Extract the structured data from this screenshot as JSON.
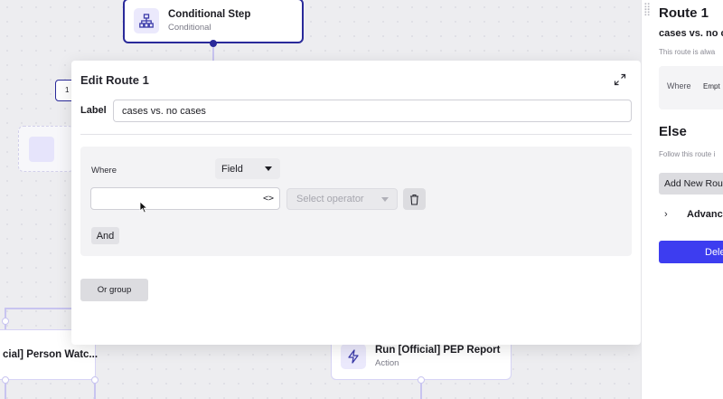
{
  "canvas": {
    "conditional_node": {
      "title": "Conditional Step",
      "subtitle": "Conditional"
    },
    "route_badge": "1",
    "person_node": {
      "title": "cial] Person Watc..."
    },
    "pep_node": {
      "title": "Run [Official] PEP Report",
      "subtitle": "Action"
    }
  },
  "modal": {
    "title": "Edit Route 1",
    "label_label": "Label",
    "label_value": "cases vs. no cases",
    "where_label": "Where",
    "field_select": "Field",
    "condition_value": "",
    "operator_placeholder": "Select operator",
    "and_button": "And",
    "or_group_button": "Or group"
  },
  "panel": {
    "title": "Route 1",
    "route_label": "cases vs. no c",
    "always_text": "This route is alwa",
    "where_label": "Where",
    "where_value": "Empt",
    "else_title": "Else",
    "follow_text": "Follow this route i",
    "add_route_button": "Add New Rou",
    "advanced_label": "Advanc",
    "delete_button": "Dele"
  },
  "colors": {
    "accent": "#3d3df0",
    "node_border_active": "#2a2a9a",
    "node_border": "#d6d3f5",
    "icon_bg": "#ebe9fc"
  },
  "icons": [
    "sitemap-icon",
    "lightning-icon",
    "expand-icon",
    "code-icon",
    "trash-icon",
    "chevron-right-icon",
    "drag-handle-icon",
    "mouse-cursor-icon"
  ]
}
